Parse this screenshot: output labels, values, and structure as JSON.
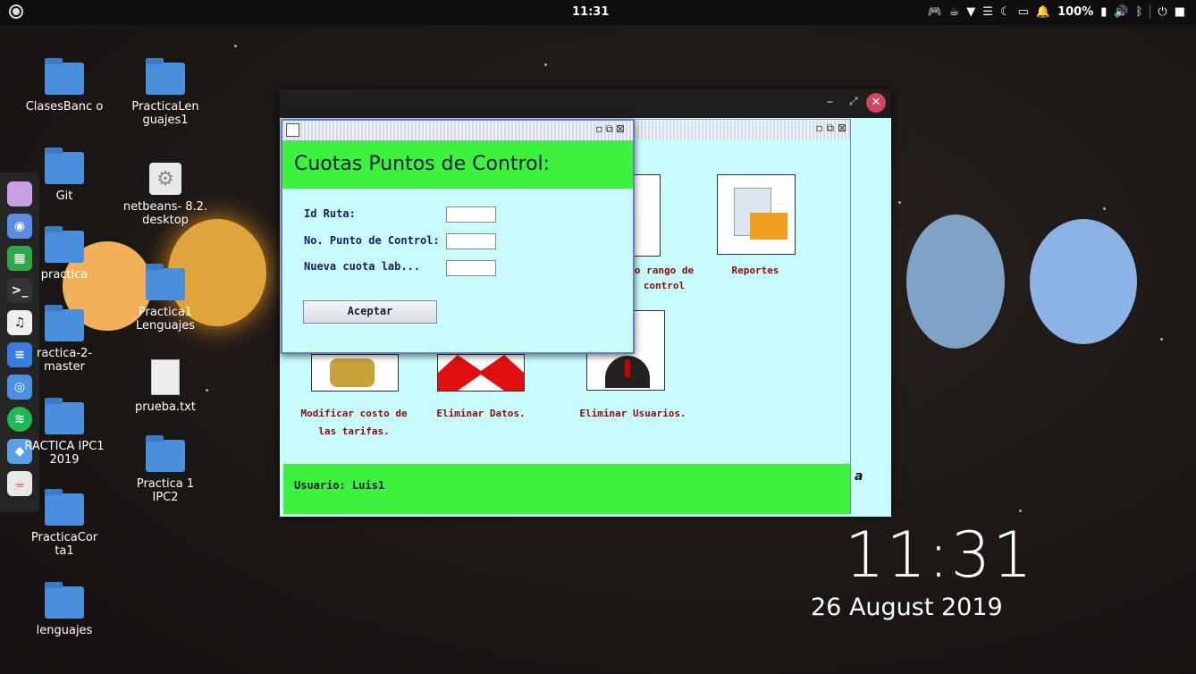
{
  "top_panel": {
    "clock": "11:31",
    "battery": "100%"
  },
  "desktop_icons": [
    {
      "label": "ClasesBanc o"
    },
    {
      "label": "PracticaLen guajes1"
    },
    {
      "label": "Git"
    },
    {
      "label": "netbeans- 8.2. desktop"
    },
    {
      "label": "practica"
    },
    {
      "label": "Practica1 Lenguajes"
    },
    {
      "label": "ractica-2- master"
    },
    {
      "label": "prueba.txt"
    },
    {
      "label": "RACTICA IPC1 2019"
    },
    {
      "label": "Practica 1 IPC2"
    },
    {
      "label": "PracticaCor ta1"
    },
    {
      "label": "lenguajes"
    }
  ],
  "desktop_clock": {
    "time": "11:31",
    "date": "26 August 2019"
  },
  "main_window": {
    "items": [
      {
        "label_line1": "o rango de",
        "label_line2": "control"
      },
      {
        "label_line1": "Reportes"
      },
      {
        "label_line1": "Modificar costo de",
        "label_line2": "las tarifas."
      },
      {
        "label_line1": "Eliminar Datos."
      },
      {
        "label_line1": "Eliminar Usuarios."
      }
    ],
    "user_label": "Usuario: Luis1",
    "side_letter": "a"
  },
  "dialog": {
    "title": "Cuotas Puntos de Control:",
    "fields": [
      {
        "label": "Id Ruta:",
        "value": ""
      },
      {
        "label": "No. Punto de Control:",
        "value": ""
      },
      {
        "label": "Nueva cuota lab...",
        "value": ""
      }
    ],
    "button": "Aceptar"
  },
  "colors": {
    "window_bg": "#c8fcfc",
    "header_green": "#3cf23c",
    "label_red": "#8b0a0a",
    "close_red": "#d3455c"
  }
}
